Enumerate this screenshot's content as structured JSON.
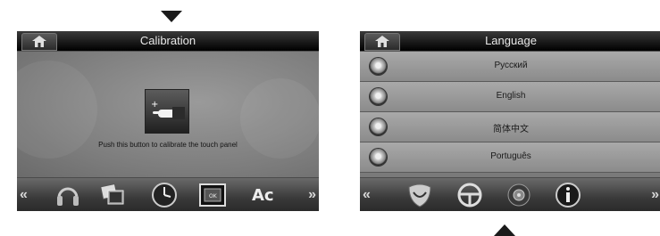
{
  "calibration_screen": {
    "title": "Calibration",
    "instruction": "Push this button to calibrate the touch panel",
    "dock_icons": [
      "headphones-icon",
      "photos-icon",
      "clock-icon",
      "calibration-ok-icon",
      "font-icon"
    ]
  },
  "language_screen": {
    "title": "Language",
    "languages": [
      "Русский",
      "English",
      "简体中文",
      "Português"
    ],
    "dock_icons": [
      "shield-icon",
      "steering-wheel-icon",
      "speaker-icon",
      "info-icon"
    ]
  },
  "dock_arrows": {
    "left": "«",
    "right": "»"
  },
  "calibration_ok_label": "OK",
  "font_icon_label": "Ac"
}
